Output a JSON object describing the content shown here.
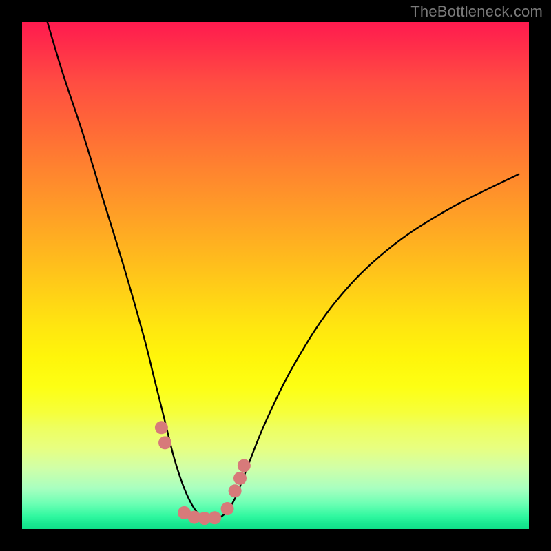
{
  "attribution": "TheBottleneck.com",
  "chart_data": {
    "type": "line",
    "title": "",
    "xlabel": "",
    "ylabel": "",
    "xlim": [
      0,
      100
    ],
    "ylim": [
      0,
      100
    ],
    "series": [
      {
        "name": "bottleneck-curve",
        "x": [
          5,
          8,
          12,
          16,
          20,
          24,
          26,
          28,
          30,
          32,
          34,
          36,
          38,
          40,
          42,
          44,
          48,
          54,
          62,
          72,
          84,
          98
        ],
        "values": [
          100,
          90,
          78,
          65,
          52,
          38,
          30,
          22,
          14,
          8,
          4,
          2,
          2,
          3,
          6,
          11,
          21,
          33,
          45,
          55,
          63,
          70
        ]
      }
    ],
    "markers": {
      "name": "highlight-points",
      "color": "#d77a7a",
      "x": [
        27.5,
        28.2,
        32.0,
        34.0,
        36.0,
        38.0,
        40.5,
        42.0,
        43.0,
        43.8
      ],
      "values": [
        20.0,
        17.0,
        3.2,
        2.3,
        2.1,
        2.2,
        4.0,
        7.5,
        10.0,
        12.5
      ]
    },
    "background": {
      "type": "vertical-gradient",
      "top_color": "#ff1a4f",
      "mid_color": "#fff50a",
      "bottom_color": "#10df88"
    }
  }
}
